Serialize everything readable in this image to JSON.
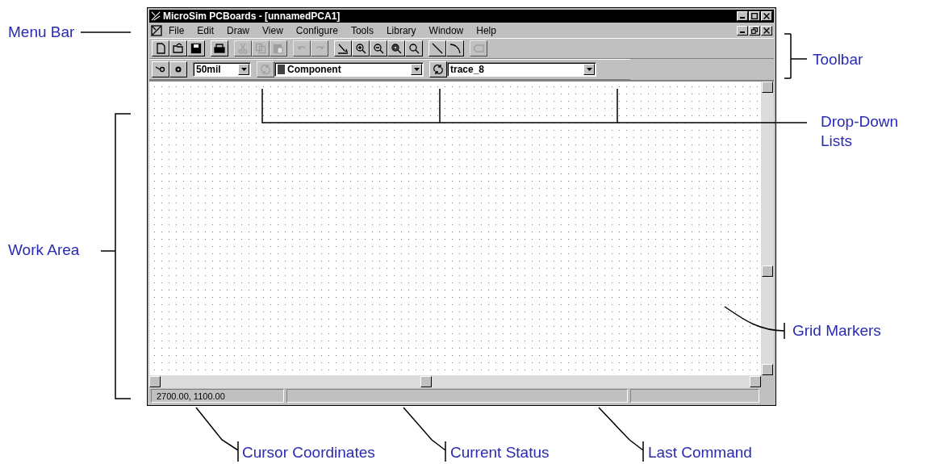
{
  "window": {
    "title": "MicroSim PCBoards - [unnamedPCA1]"
  },
  "menu_bar": [
    "File",
    "Edit",
    "Draw",
    "View",
    "Configure",
    "Tools",
    "Library",
    "Window",
    "Help"
  ],
  "toolbar": {
    "buttons": [
      {
        "disabled": false
      },
      {
        "disabled": false
      },
      {
        "disabled": false
      },
      {
        "disabled": false
      },
      {
        "disabled": true
      },
      {
        "disabled": true
      },
      {
        "disabled": true
      },
      {
        "disabled": true
      },
      {
        "disabled": true
      },
      {
        "disabled": false
      },
      {
        "disabled": false
      },
      {
        "disabled": false
      },
      {
        "disabled": false
      },
      {
        "disabled": false
      },
      {
        "disabled": false
      },
      {
        "disabled": false
      },
      {
        "disabled": true
      }
    ]
  },
  "drop_downs": [
    {
      "value": "50mil"
    },
    {
      "value": "Component"
    },
    {
      "value": "trace_8"
    }
  ],
  "refresh_buttons": [
    {
      "disabled": true
    },
    {
      "disabled": false
    }
  ],
  "status_bar": {
    "coordinates": "2700.00, 1100.00"
  },
  "annotations": [
    {
      "label": "Menu Bar"
    },
    {
      "label": "Toolbar"
    },
    {
      "label": "Drop-Down Lists"
    },
    {
      "label": "Work Area"
    },
    {
      "label": "Grid Markers"
    },
    {
      "label": "Cursor Coordinates"
    },
    {
      "label": "Current Status"
    },
    {
      "label": "Last Command"
    }
  ]
}
